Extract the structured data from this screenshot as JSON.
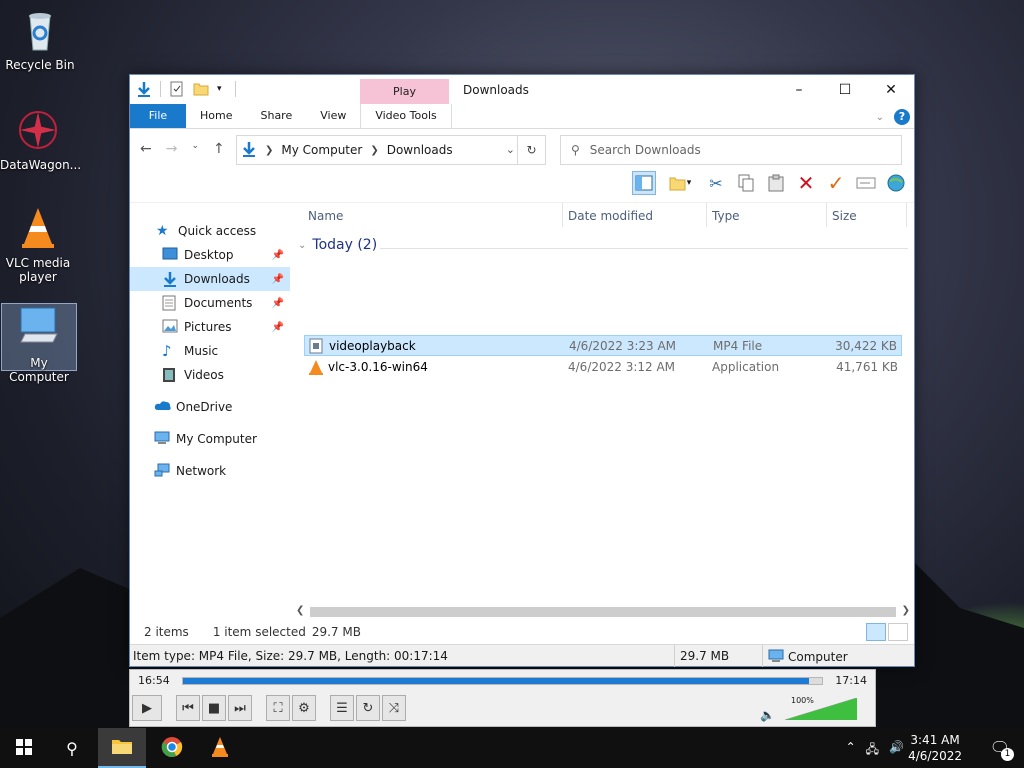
{
  "desktop": {
    "icons": [
      {
        "label": "Recycle Bin",
        "icon": "recycle-bin-icon"
      },
      {
        "label": "DataWagon...",
        "icon": "datawagon-icon"
      },
      {
        "label": "VLC media player",
        "icon": "vlc-icon"
      },
      {
        "label": "My Computer",
        "icon": "computer-icon"
      }
    ]
  },
  "explorer": {
    "context_tab": "Play",
    "title": "Downloads",
    "ribbon_tabs": [
      "File",
      "Home",
      "Share",
      "View",
      "Video Tools"
    ],
    "address": {
      "root": "My Computer",
      "current": "Downloads"
    },
    "search_placeholder": "Search Downloads",
    "nav_pane": [
      {
        "label": "Quick access",
        "icon": "star-icon"
      },
      {
        "label": "Desktop",
        "icon": "desktop-folder-icon",
        "pinned": true
      },
      {
        "label": "Downloads",
        "icon": "downloads-folder-icon",
        "pinned": true,
        "selected": true
      },
      {
        "label": "Documents",
        "icon": "documents-folder-icon",
        "pinned": true
      },
      {
        "label": "Pictures",
        "icon": "pictures-folder-icon",
        "pinned": true
      },
      {
        "label": "Music",
        "icon": "music-folder-icon"
      },
      {
        "label": "Videos",
        "icon": "videos-folder-icon"
      },
      {
        "label": "OneDrive",
        "icon": "cloud-icon"
      },
      {
        "label": "My Computer",
        "icon": "computer-icon"
      },
      {
        "label": "Network",
        "icon": "network-icon"
      }
    ],
    "columns": [
      "Name",
      "Date modified",
      "Type",
      "Size"
    ],
    "group_label": "Today (2)",
    "files": [
      {
        "name": "videoplayback",
        "date": "4/6/2022 3:23 AM",
        "type": "MP4 File",
        "size": "30,422 KB",
        "selected": true
      },
      {
        "name": "vlc-3.0.16-win64",
        "date": "4/6/2022 3:12 AM",
        "type": "Application",
        "size": "41,761 KB"
      }
    ],
    "status": {
      "items": "2 items",
      "selected": "1 item selected",
      "sel_size": "29.7 MB"
    },
    "details": {
      "item_type": "Item type: MP4 File, Size: 29.7 MB, Length: 00:17:14",
      "size": "29.7 MB",
      "location": "Computer"
    }
  },
  "vlc": {
    "elapsed": "16:54",
    "total": "17:14",
    "progress": 0.98,
    "volume": "100%",
    "volume_level": 1.0
  },
  "taskbar": {
    "time": "3:41 AM",
    "date": "4/6/2022",
    "notifications": "1"
  }
}
